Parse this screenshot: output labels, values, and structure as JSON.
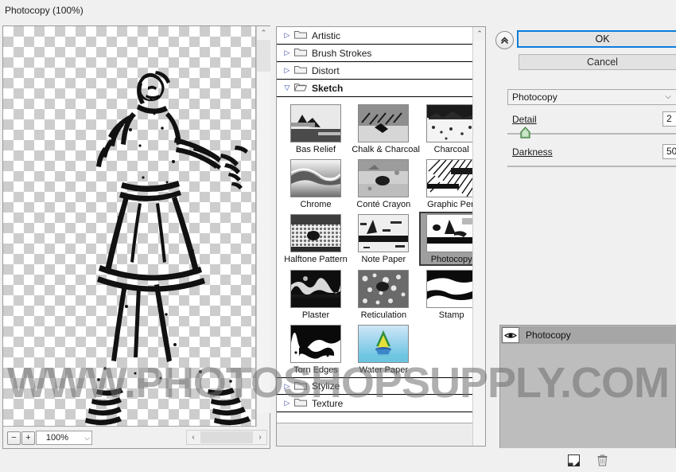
{
  "window": {
    "title": "Photocopy (100%)"
  },
  "watermark": {
    "text": "WWW.PHOTOSHOPSUPPLY.COM"
  },
  "preview": {
    "zoom_out_label": "−",
    "zoom_in_label": "+",
    "zoom_level": "100%",
    "zoom_arrow": "⌵",
    "scroll_up": "⌃",
    "scroll_left": "‹",
    "scroll_right": "›"
  },
  "categories": [
    {
      "label": "Artistic",
      "expanded": false,
      "arrow": "▷"
    },
    {
      "label": "Brush Strokes",
      "expanded": false,
      "arrow": "▷"
    },
    {
      "label": "Distort",
      "expanded": false,
      "arrow": "▷"
    },
    {
      "label": "Sketch",
      "expanded": true,
      "arrow": "▽"
    }
  ],
  "categories_bottom": [
    {
      "label": "Stylize",
      "expanded": false,
      "arrow": "▷"
    },
    {
      "label": "Texture",
      "expanded": false,
      "arrow": "▷"
    }
  ],
  "filters": [
    {
      "label": "Bas Relief",
      "selected": false
    },
    {
      "label": "Chalk & Charcoal",
      "selected": false
    },
    {
      "label": "Charcoal",
      "selected": false
    },
    {
      "label": "Chrome",
      "selected": false
    },
    {
      "label": "Conté Crayon",
      "selected": false
    },
    {
      "label": "Graphic Pen",
      "selected": false
    },
    {
      "label": "Halftone Pattern",
      "selected": false
    },
    {
      "label": "Note Paper",
      "selected": false
    },
    {
      "label": "Photocopy",
      "selected": true
    },
    {
      "label": "Plaster",
      "selected": false
    },
    {
      "label": "Reticulation",
      "selected": false
    },
    {
      "label": "Stamp",
      "selected": false
    },
    {
      "label": "Torn Edges",
      "selected": false
    },
    {
      "label": "Water Paper",
      "selected": false
    }
  ],
  "panel": {
    "collapse_icon": "«",
    "ok_label": "OK",
    "cancel_label": "Cancel",
    "selected_filter": "Photocopy",
    "select_arrow": "⌵",
    "params": [
      {
        "name": "Detail",
        "value": "2",
        "percent": 8
      },
      {
        "name": "Darkness",
        "value": "50",
        "percent": 99
      }
    ],
    "effects": {
      "layer_name": "Photocopy",
      "eye_icon": "eye-icon"
    },
    "toolbar": {
      "new_effect_icon": "new-effect-layer-icon",
      "delete_icon": "trash-icon"
    }
  },
  "colors": {
    "accent": "#0a7ddb",
    "selection": "#9f9f9f",
    "panel_bg": "#f0f0f0",
    "layer_bg": "#a6a6a6"
  }
}
